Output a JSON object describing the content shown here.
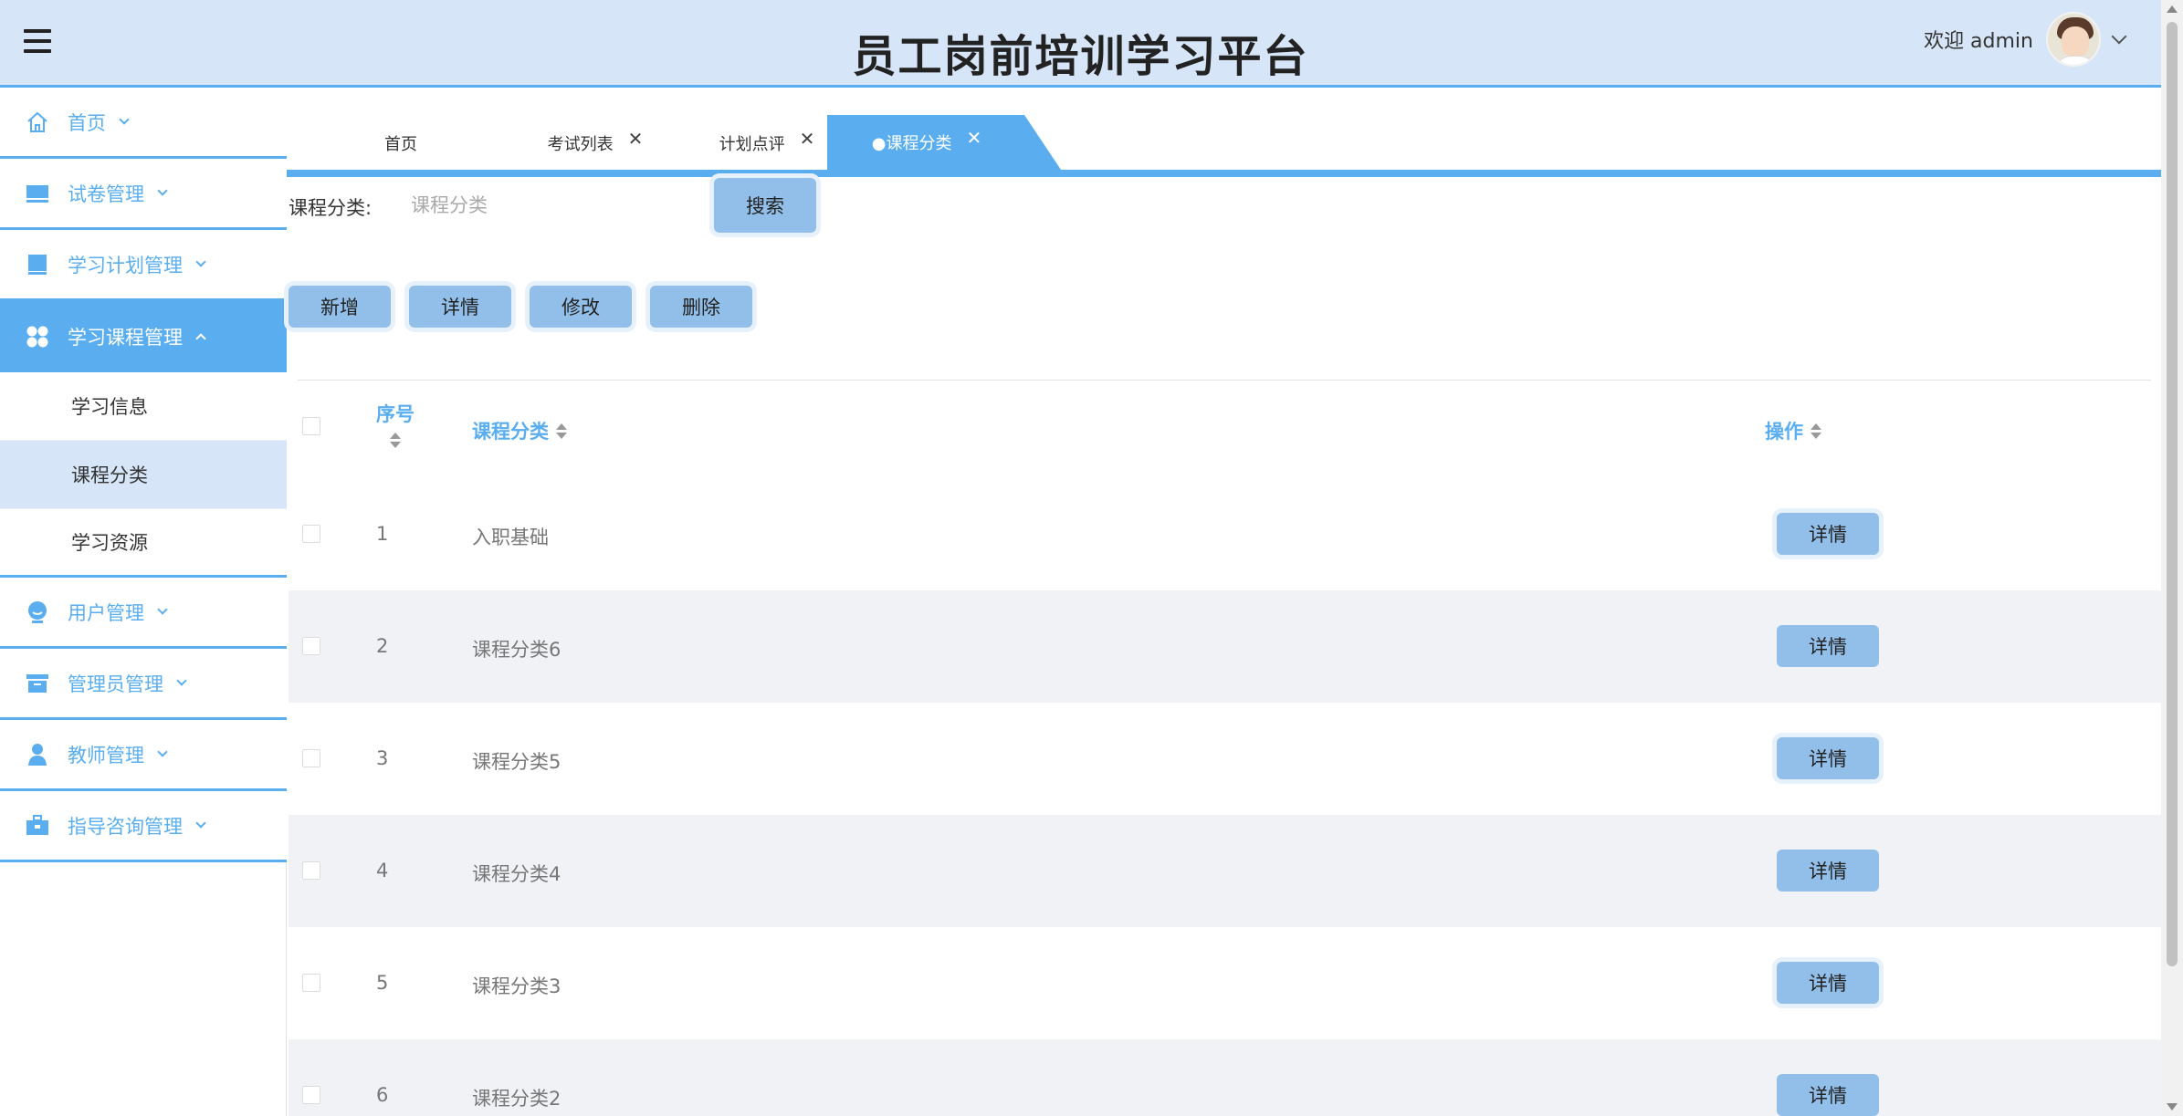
{
  "header": {
    "title": "员工岗前培训学习平台",
    "welcome": "欢迎 admin"
  },
  "sidebar": {
    "items": [
      {
        "label": "首页",
        "icon": "home-icon"
      },
      {
        "label": "试卷管理",
        "icon": "monitor-icon"
      },
      {
        "label": "学习计划管理",
        "icon": "book-icon"
      },
      {
        "label": "学习课程管理",
        "icon": "apps-icon"
      },
      {
        "label": "用户管理",
        "icon": "user-icon"
      },
      {
        "label": "管理员管理",
        "icon": "archive-icon"
      },
      {
        "label": "教师管理",
        "icon": "teacher-icon"
      },
      {
        "label": "指导咨询管理",
        "icon": "briefcase-icon"
      }
    ],
    "sub_items": [
      "学习信息",
      "课程分类",
      "学习资源"
    ]
  },
  "tabs": [
    {
      "label": "首页"
    },
    {
      "label": "考试列表"
    },
    {
      "label": "计划点评"
    },
    {
      "label": "●课程分类"
    }
  ],
  "search": {
    "label": "课程分类:",
    "placeholder": "课程分类",
    "button": "搜索"
  },
  "toolbar": {
    "add": "新增",
    "detail": "详情",
    "edit": "修改",
    "delete": "删除"
  },
  "table": {
    "headers": {
      "index": "序号",
      "category": "课程分类",
      "action": "操作"
    },
    "action_label": "详情",
    "rows": [
      {
        "index": "1",
        "category": "入职基础"
      },
      {
        "index": "2",
        "category": "课程分类6"
      },
      {
        "index": "3",
        "category": "课程分类5"
      },
      {
        "index": "4",
        "category": "课程分类4"
      },
      {
        "index": "5",
        "category": "课程分类3"
      },
      {
        "index": "6",
        "category": "课程分类2"
      }
    ]
  },
  "colors": {
    "accent": "#5aaef0",
    "header_bg": "#d6e6f8",
    "button_bg": "#92bfe9"
  }
}
